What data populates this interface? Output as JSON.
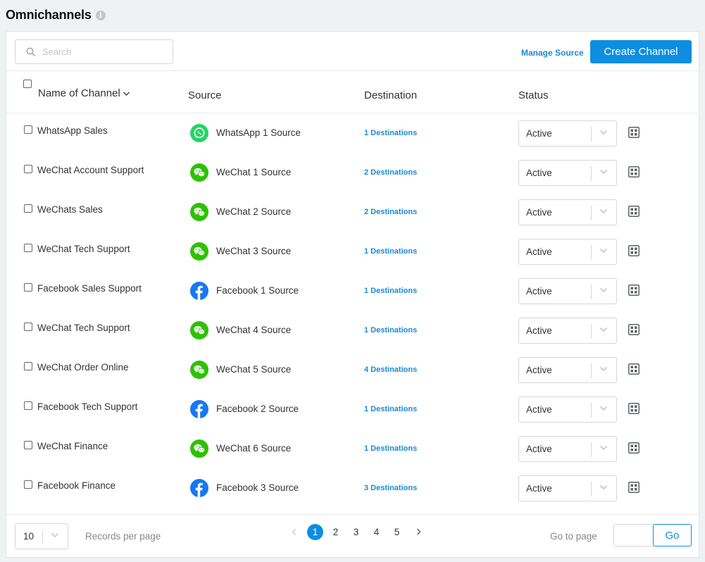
{
  "header": {
    "title": "Omnichannels"
  },
  "toolbar": {
    "search_placeholder": "Search",
    "manage_source_label": "Manage Source",
    "create_channel_label": "Create Channel"
  },
  "table": {
    "columns": {
      "name": "Name of Channel",
      "source": "Source",
      "destination": "Destination",
      "status": "Status"
    },
    "rows": [
      {
        "name": "WhatsApp Sales",
        "source_type": "whatsapp",
        "source": "WhatsApp 1 Source",
        "destinations": "1 Destinations",
        "status": "Active"
      },
      {
        "name": "WeChat Account Support",
        "source_type": "wechat",
        "source": "WeChat 1 Source",
        "destinations": "2 Destinations",
        "status": "Active"
      },
      {
        "name": "WeChats Sales",
        "source_type": "wechat",
        "source": "WeChat 2 Source",
        "destinations": "2 Destinations",
        "status": "Active"
      },
      {
        "name": "WeChat Tech Support",
        "source_type": "wechat",
        "source": "WeChat 3 Source",
        "destinations": "1 Destinations",
        "status": "Active"
      },
      {
        "name": "Facebook Sales Support",
        "source_type": "facebook",
        "source": "Facebook 1 Source",
        "destinations": "1 Destinations",
        "status": "Active"
      },
      {
        "name": "WeChat Tech Support",
        "source_type": "wechat",
        "source": "WeChat 4 Source",
        "destinations": "1 Destinations",
        "status": "Active"
      },
      {
        "name": "WeChat Order Online",
        "source_type": "wechat",
        "source": "WeChat 5 Source",
        "destinations": "4 Destinations",
        "status": "Active"
      },
      {
        "name": "Facebook Tech Support",
        "source_type": "facebook",
        "source": "Facebook 2 Source",
        "destinations": "1 Destinations",
        "status": "Active"
      },
      {
        "name": "WeChat Finance",
        "source_type": "wechat",
        "source": "WeChat 6 Source",
        "destinations": "1 Destinations",
        "status": "Active"
      },
      {
        "name": "Facebook Finance",
        "source_type": "facebook",
        "source": "Facebook 3 Source",
        "destinations": "3 Destinations",
        "status": "Active"
      }
    ]
  },
  "footer": {
    "per_page": "10",
    "records_per_page_label": "Records per page",
    "pages": [
      "1",
      "2",
      "3",
      "4",
      "5"
    ],
    "current_page": "1",
    "go_to_page_label": "Go to page",
    "go_label": "Go"
  },
  "colors": {
    "accent": "#0d8ee0",
    "whatsapp": "#25d366",
    "wechat": "#2dc100",
    "facebook": "#1877f2"
  },
  "icons": {
    "whatsapp": "whatsapp-icon",
    "wechat": "wechat-icon",
    "facebook": "facebook-icon",
    "row_action": "qr-code-icon"
  }
}
